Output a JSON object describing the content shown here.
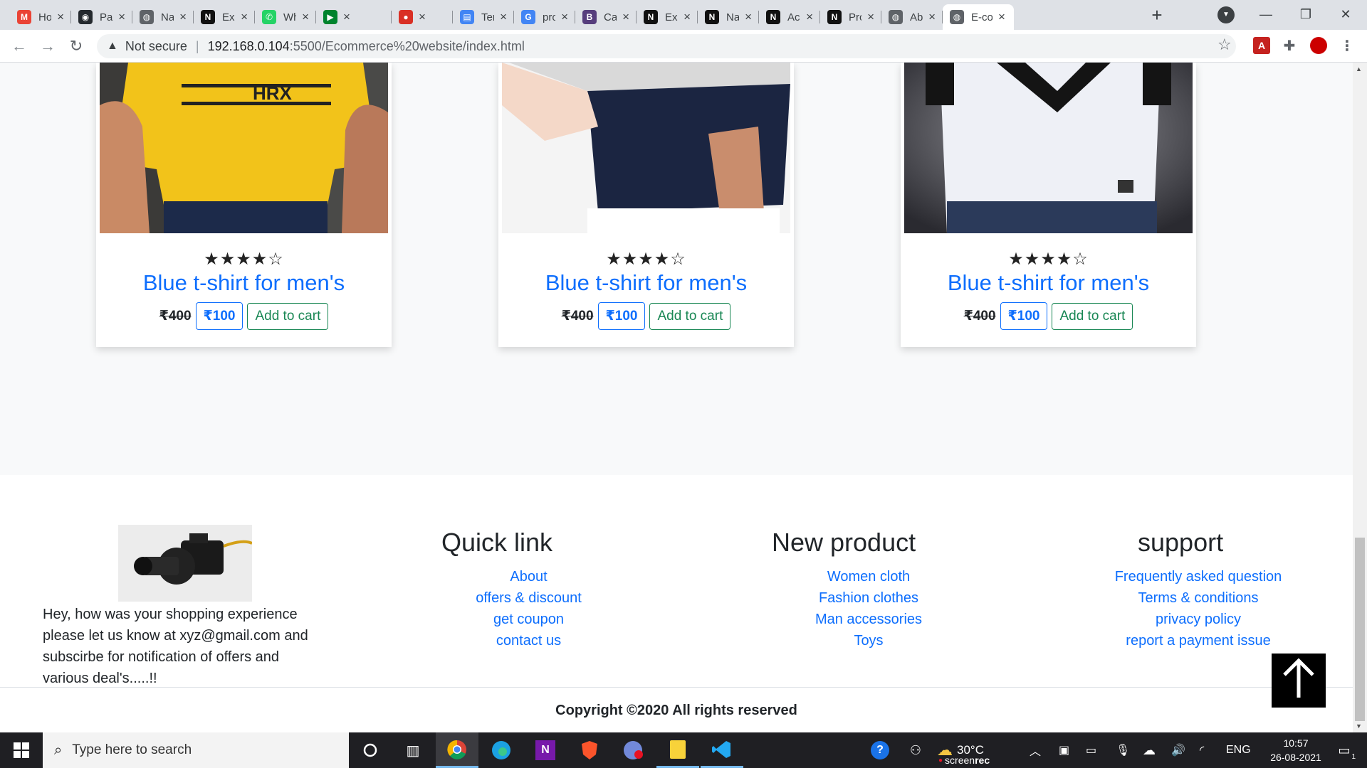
{
  "browser": {
    "tabs": [
      {
        "title": "How",
        "favicon": "gmail-icon",
        "color": "#ea4335",
        "glyph": "M"
      },
      {
        "title": "Page",
        "favicon": "github-icon",
        "color": "#24292e",
        "glyph": "◉"
      },
      {
        "title": "Nail",
        "favicon": "globe-icon",
        "color": "#5f6368",
        "glyph": "◍"
      },
      {
        "title": "Exp",
        "favicon": "site-logo-icon",
        "color": "#111",
        "glyph": "N"
      },
      {
        "title": "Wha",
        "favicon": "whatsapp-icon",
        "color": "#25d366",
        "glyph": "✆"
      },
      {
        "title": "",
        "favicon": "meet-icon",
        "color": "#00832d",
        "glyph": "▶"
      },
      {
        "title": "",
        "favicon": "record-icon",
        "color": "#d93025",
        "glyph": "●"
      },
      {
        "title": "Ten",
        "favicon": "doc-icon",
        "color": "#4285f4",
        "glyph": "▤"
      },
      {
        "title": "pro",
        "favicon": "google-icon",
        "color": "#4285f4",
        "glyph": "G"
      },
      {
        "title": "Car",
        "favicon": "bootstrap-icon",
        "color": "#563d7c",
        "glyph": "B"
      },
      {
        "title": "Exp",
        "favicon": "site-logo-icon",
        "color": "#111",
        "glyph": "N"
      },
      {
        "title": "Nail",
        "favicon": "site-logo-icon",
        "color": "#111",
        "glyph": "N"
      },
      {
        "title": "Acc",
        "favicon": "site-logo-icon",
        "color": "#111",
        "glyph": "N"
      },
      {
        "title": "Proj",
        "favicon": "site-logo-icon",
        "color": "#111",
        "glyph": "N"
      },
      {
        "title": "Abc",
        "favicon": "globe-icon",
        "color": "#5f6368",
        "glyph": "◍"
      },
      {
        "title": "E-co",
        "favicon": "globe-icon",
        "color": "#5f6368",
        "glyph": "◍",
        "active": true
      }
    ],
    "security_label": "Not secure",
    "url_host": "192.168.0.104",
    "url_path": ":5500/Ecommerce%20website/index.html"
  },
  "products": [
    {
      "rating": 4,
      "max_rating": 5,
      "title": "Blue t-shirt for men's",
      "old_price": "₹400",
      "price": "₹100",
      "cart_label": "Add to cart",
      "image": "yellow-hrx-tshirt",
      "shirt_text": "HRX"
    },
    {
      "rating": 4,
      "max_rating": 5,
      "title": "Blue t-shirt for men's",
      "old_price": "₹400",
      "price": "₹100",
      "cart_label": "Add to cart",
      "image": "navy-white-tshirt"
    },
    {
      "rating": 4,
      "max_rating": 5,
      "title": "Blue t-shirt for men's",
      "old_price": "₹400",
      "price": "₹100",
      "cart_label": "Add to cart",
      "image": "white-black-v-tshirt"
    }
  ],
  "footer": {
    "about_text": "Hey, how was your shopping experience please let us know at xyz@gmail.com and subscirbe for notification of offers and various deal's.....!!",
    "columns": [
      {
        "heading": "Quick link",
        "links": [
          "About",
          "offers & discount",
          "get coupon",
          "contact us"
        ]
      },
      {
        "heading": "New product",
        "links": [
          "Women cloth",
          "Fashion clothes",
          "Man accessories",
          "Toys"
        ]
      },
      {
        "heading": "support",
        "links": [
          "Frequently asked question",
          "Terms & conditions",
          "privacy policy",
          "report a payment issue"
        ]
      }
    ],
    "copyright": "Copyright ©2020 All rights reserved"
  },
  "taskbar": {
    "search_placeholder": "Type here to search",
    "weather": "30°C",
    "language": "ENG",
    "time": "10:57",
    "date": "26-08-2021",
    "notification_count": "1",
    "watermark_a": "screen",
    "watermark_b": "rec"
  },
  "colors": {
    "link": "#0d6efd",
    "success": "#198754",
    "star": "#222222"
  }
}
